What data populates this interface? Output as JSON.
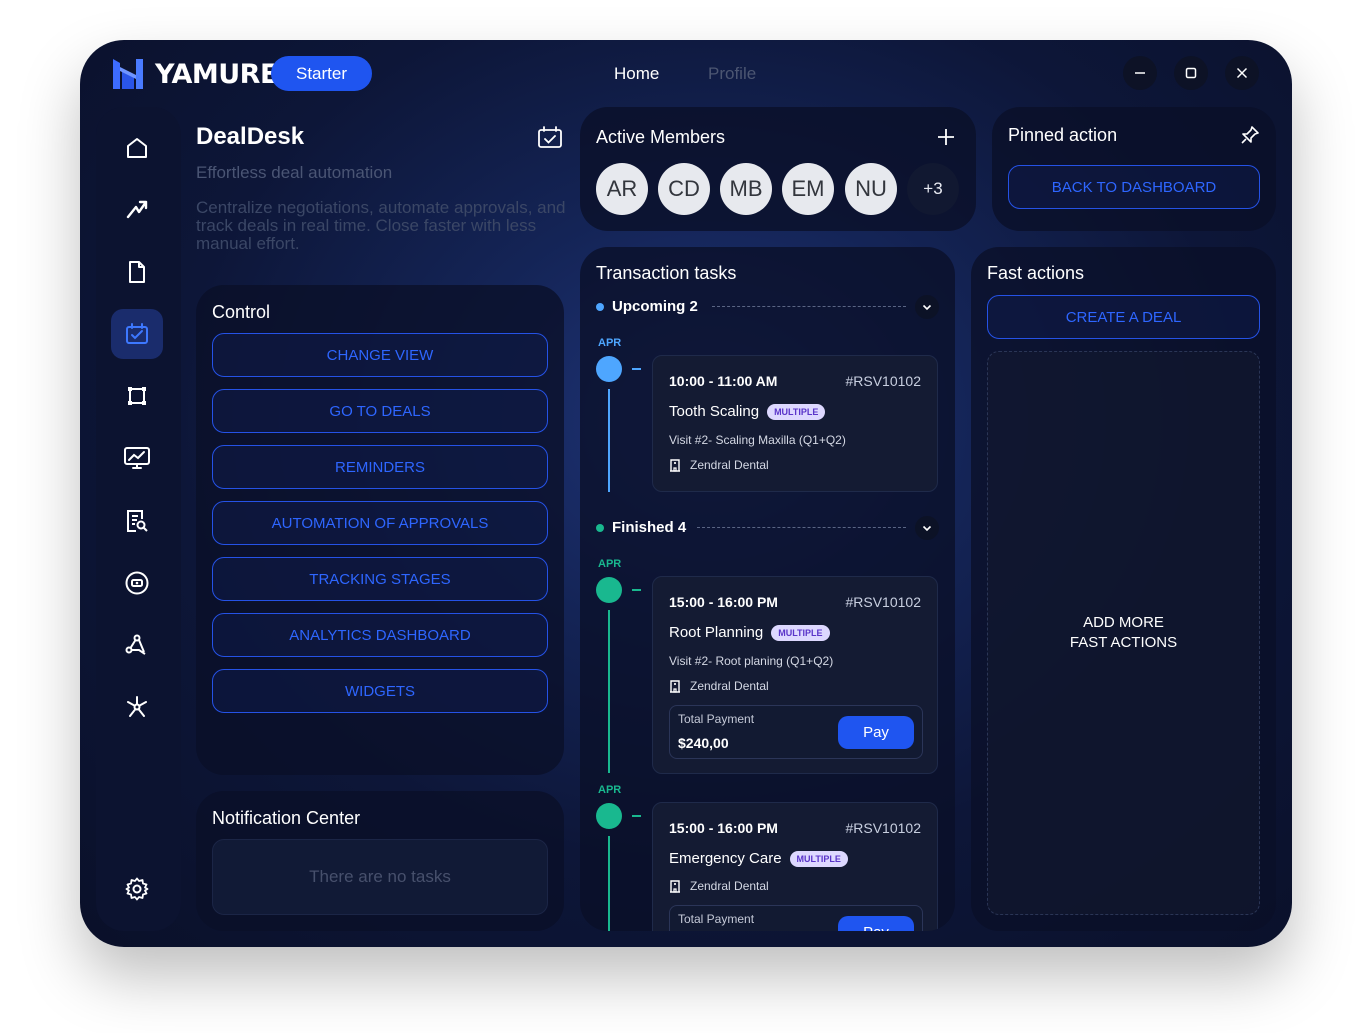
{
  "app": {
    "logo_text": "YAMURE",
    "plan_badge": "Starter",
    "nav": {
      "home": "Home",
      "profile": "Profile"
    }
  },
  "colors": {
    "accent": "#1f55f0",
    "upcoming": "#4ea6ff",
    "finished": "#19b88f"
  },
  "sidebar": {
    "items": [
      {
        "icon": "home-icon"
      },
      {
        "icon": "trend-arrow-icon"
      },
      {
        "icon": "document-icon"
      },
      {
        "icon": "calendar-check-icon",
        "active": true
      },
      {
        "icon": "crop-frame-icon"
      },
      {
        "icon": "monitor-chart-icon"
      },
      {
        "icon": "report-search-icon"
      },
      {
        "icon": "record-circle-icon"
      },
      {
        "icon": "vector-pen-icon"
      },
      {
        "icon": "network-star-icon"
      }
    ],
    "settings_icon": "gear-icon"
  },
  "dealdesk": {
    "title": "DealDesk",
    "subtitle": "Effortless deal automation",
    "description": "Centralize negotiations, automate approvals, and track deals in real time. Close faster with less manual effort."
  },
  "control": {
    "title": "Control",
    "buttons": [
      "CHANGE VIEW",
      "GO TO DEALS",
      "REMINDERS",
      "AUTOMATION OF APPROVALS",
      "TRACKING STAGES",
      "ANALYTICS DASHBOARD",
      "WIDGETS"
    ]
  },
  "notifications": {
    "title": "Notification Center",
    "empty": "There are no tasks"
  },
  "members": {
    "title": "Active Members",
    "avatars": [
      "AR",
      "CD",
      "MB",
      "EM",
      "NU"
    ],
    "more": "+3"
  },
  "pinned": {
    "title": "Pinned action",
    "button": "BACK TO DASHBOARD"
  },
  "tasks": {
    "title": "Transaction tasks",
    "upcoming": {
      "label": "Upcoming",
      "count": "2",
      "items": [
        {
          "month": "APR",
          "time": "10:00 - 11:00 AM",
          "id": "#RSV10102",
          "name": "Tooth Scaling",
          "tag": "MULTIPLE",
          "visit": "Visit #2- Scaling Maxilla (Q1+Q2)",
          "clinic": "Zendral Dental"
        }
      ]
    },
    "finished": {
      "label": "Finished",
      "count": "4",
      "items": [
        {
          "month": "APR",
          "time": "15:00 - 16:00 PM",
          "id": "#RSV10102",
          "name": "Root Planning",
          "tag": "MULTIPLE",
          "visit": "Visit #2- Root planing (Q1+Q2)",
          "clinic": "Zendral Dental",
          "payment_label": "Total Payment",
          "payment_amount": "$240,00",
          "pay_button": "Pay"
        },
        {
          "month": "APR",
          "time": "15:00 - 16:00 PM",
          "id": "#RSV10102",
          "name": "Emergency Care",
          "tag": "MULTIPLE",
          "clinic": "Zendral Dental",
          "payment_label": "Total Payment",
          "pay_button": "Pay"
        }
      ]
    }
  },
  "fast_actions": {
    "title": "Fast actions",
    "button": "CREATE A DEAL",
    "add_more_line1": "ADD MORE",
    "add_more_line2": "FAST ACTIONS"
  }
}
